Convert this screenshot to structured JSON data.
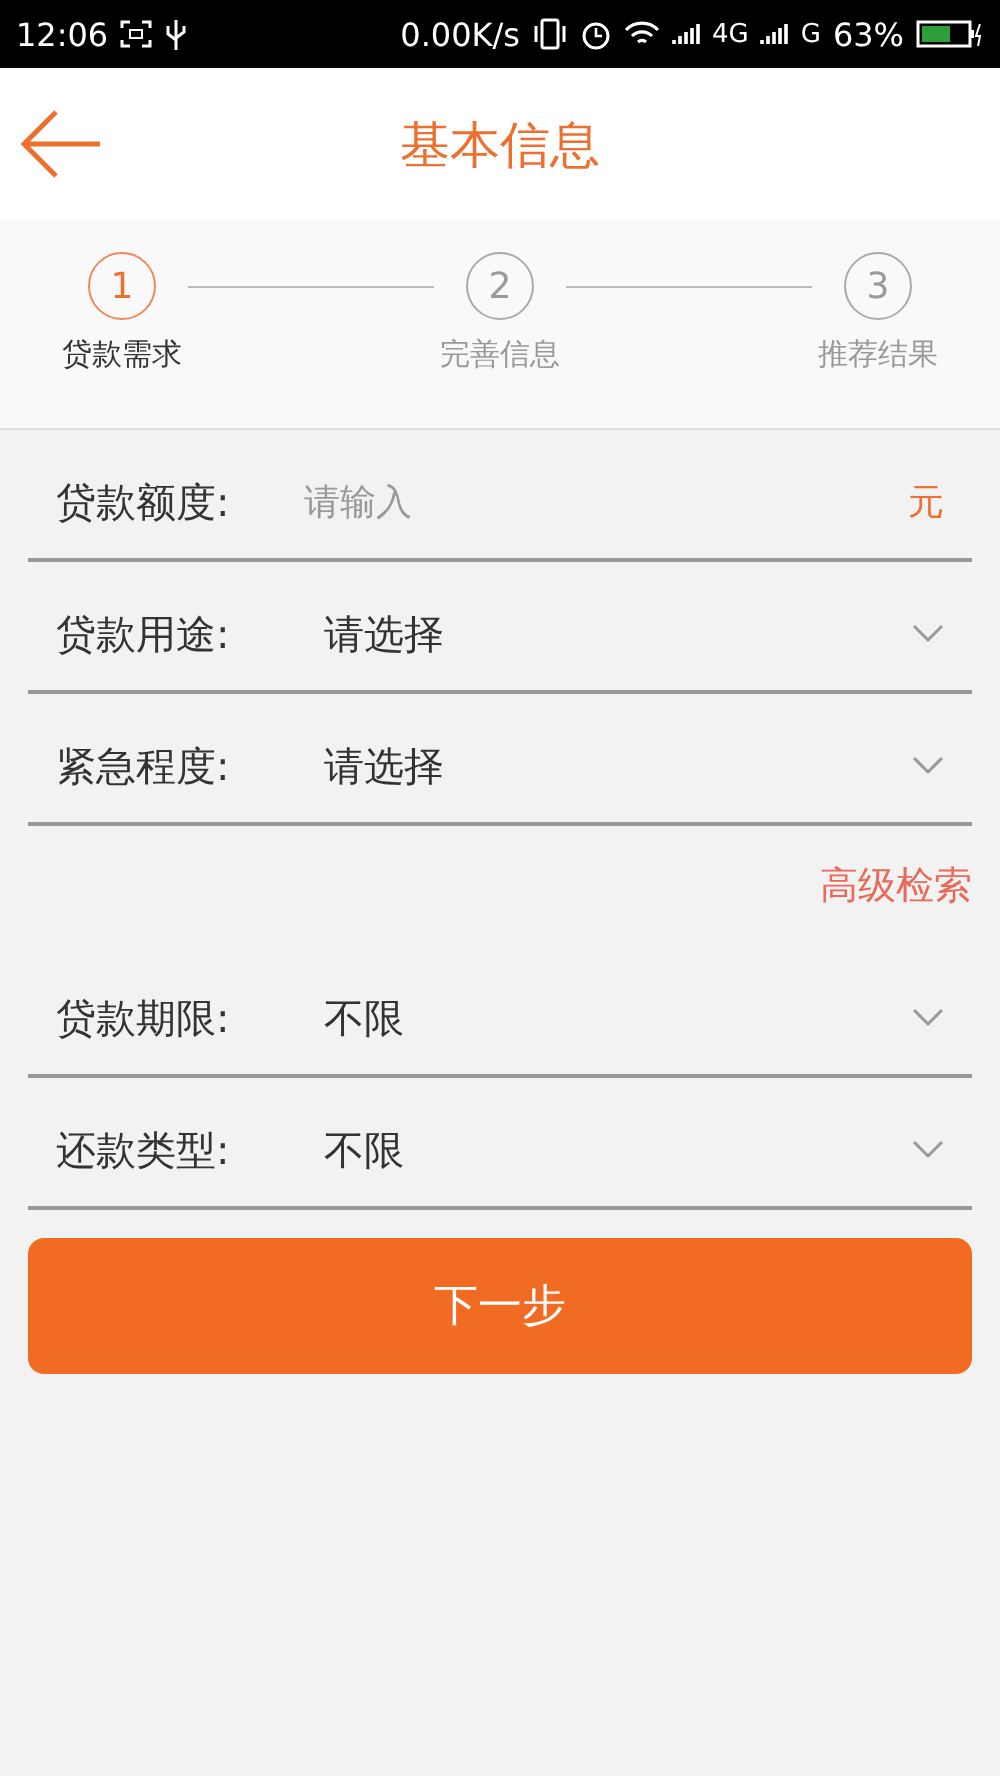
{
  "status_bar": {
    "time": "12:06",
    "speed": "0.00K/s",
    "net1": "4G",
    "net2": "G",
    "battery": "63%"
  },
  "header": {
    "title": "基本信息"
  },
  "steps": [
    {
      "number": "1",
      "label": "贷款需求",
      "selected": true
    },
    {
      "number": "2",
      "label": "完善信息",
      "selected": false
    },
    {
      "number": "3",
      "label": "推荐结果",
      "selected": false
    }
  ],
  "fields": [
    {
      "kind": "input",
      "label": "贷款额度:",
      "placeholder": "请输入",
      "unit": "元"
    },
    {
      "kind": "select",
      "label": "贷款用途:",
      "value": "请选择"
    },
    {
      "kind": "select",
      "label": "紧急程度:",
      "value": "请选择"
    },
    {
      "kind": "link",
      "label": "高级检索"
    },
    {
      "kind": "select",
      "label": "贷款期限:",
      "value": "不限"
    },
    {
      "kind": "select",
      "label": "还款类型:",
      "value": "不限"
    }
  ],
  "next_button": "下一步"
}
